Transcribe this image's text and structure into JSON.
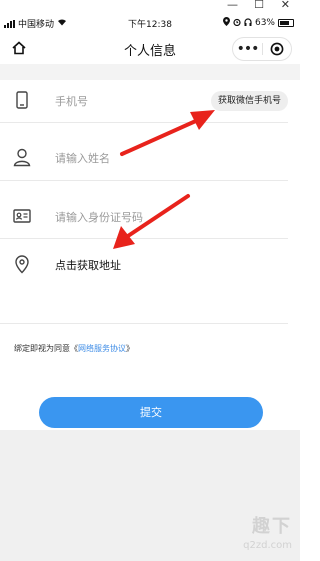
{
  "window": {
    "minimize": "—",
    "maximize": "☐",
    "close": "✕"
  },
  "status_bar": {
    "carrier": "中国移动",
    "time": "下午12:38",
    "battery": "63%"
  },
  "nav": {
    "title": "个人信息"
  },
  "form": {
    "phone_placeholder": "手机号",
    "wechat_phone_button": "获取微信手机号",
    "name_placeholder": "请输入姓名",
    "id_placeholder": "请输入身份证号码",
    "address_button": "点击获取地址"
  },
  "agreement": {
    "prefix": "绑定即视为同意《",
    "link": "网络服务协议",
    "suffix": "》"
  },
  "submit_label": "提交",
  "watermark": {
    "main": "趣下",
    "sub": "q2zd.com"
  },
  "colors": {
    "accent": "#3a96f0",
    "arrow": "#e8231c",
    "link": "#3e8ce6"
  }
}
